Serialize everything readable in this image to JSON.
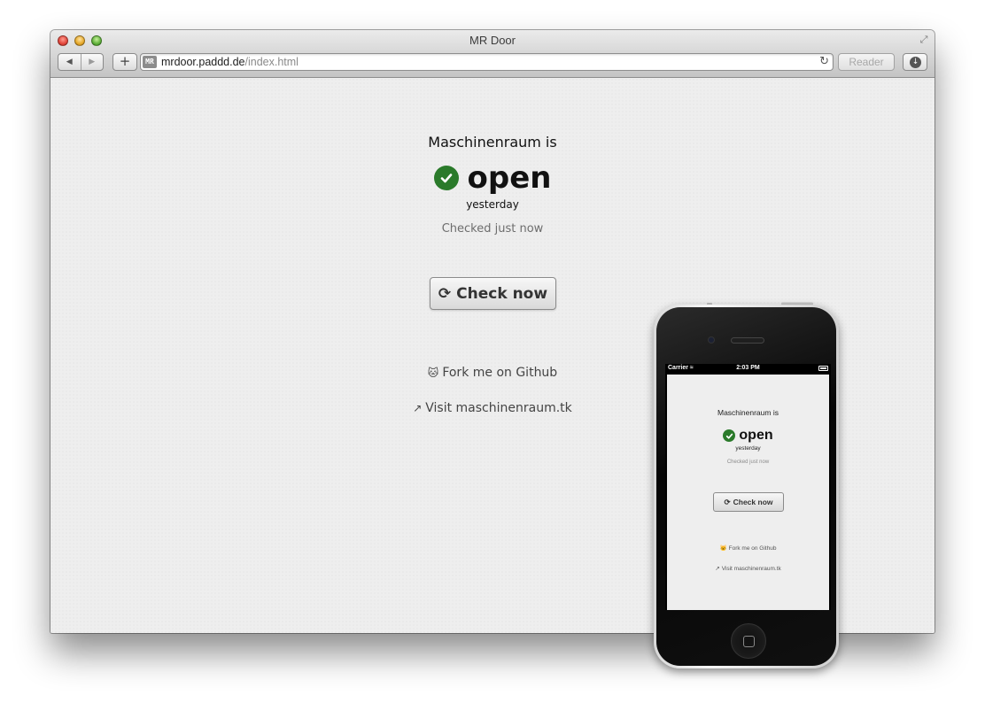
{
  "browser": {
    "window_title": "MR Door",
    "url_host": "mrdoor.paddd.de",
    "url_path": "/index.html",
    "favicon_text": "MR",
    "reader_label": "Reader",
    "add_tab_label": "+",
    "back_icon": "◀",
    "forward_icon": "▶",
    "reload_icon": "↻",
    "fullscreen_icon": "⤢",
    "download_icon": "↓"
  },
  "page": {
    "prefix": "Maschinenraum is",
    "status": "open",
    "since": "yesterday",
    "checked": "Checked just now",
    "button_label": "Check now",
    "refresh_icon": "⟳",
    "github_icon": "🐱",
    "github_link": "Fork me on Github",
    "external_icon": "↗",
    "visit_link": "Visit maschinenraum.tk",
    "status_color": "#2a7a2a"
  },
  "phone": {
    "carrier": "Carrier",
    "time": "2:03 PM",
    "wifi_icon": "≈",
    "prefix": "Maschinenraum is",
    "status": "open",
    "since": "yesterday",
    "checked": "Checked just now",
    "button_label": "Check now",
    "refresh_icon": "⟳",
    "github_icon": "🐱",
    "github_link": "Fork me on Github",
    "external_icon": "↗",
    "visit_link": "Visit maschinenraum.tk"
  }
}
